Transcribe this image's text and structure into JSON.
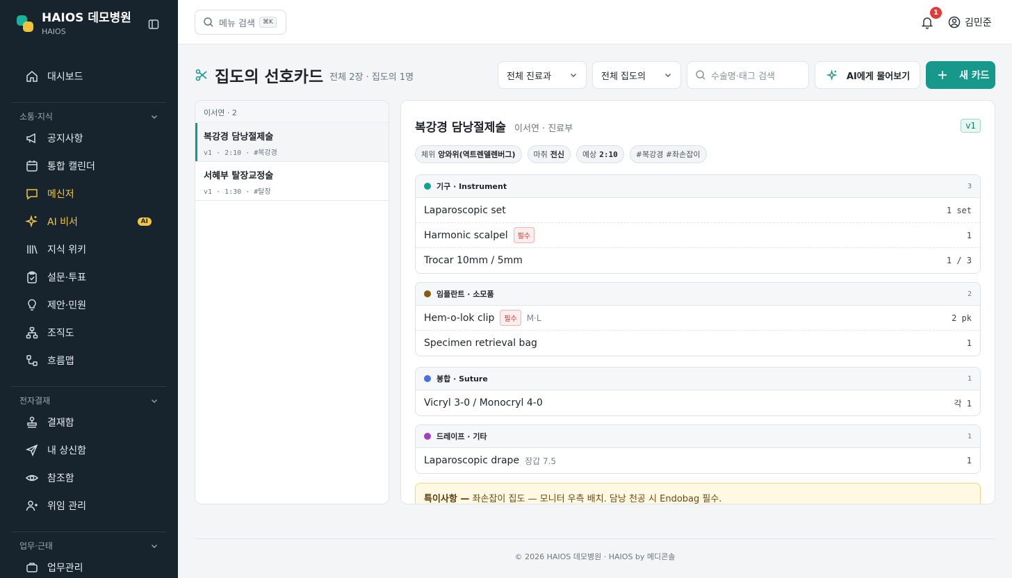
{
  "sidebar": {
    "brand_title": "HAIOS 데모병원",
    "brand_sub": "HAIOS",
    "main_item": "대시보드",
    "section1_label": "소통·지식",
    "section1_items": [
      "공지사항",
      "통합 캘린더",
      "메신저",
      "AI 비서",
      "지식 위키",
      "설문·투표",
      "제안·민원",
      "조직도",
      "흐름맵"
    ],
    "ai_badge": "AI",
    "section2_label": "전자결재",
    "section2_items": [
      "결재함",
      "내 상신함",
      "참조함",
      "위임 관리"
    ],
    "section3_label": "업무·근태",
    "section3_items": [
      "업무관리"
    ],
    "accent_color": "#f2c542"
  },
  "topbar": {
    "search_placeholder": "메뉴 검색",
    "shortcut": "⌘K",
    "notification_count": "1",
    "user_name": "김민준"
  },
  "page": {
    "title": "집도의 선호카드",
    "meta": "전체 2장 · 집도의 1명",
    "filter_dept": "전체 진료과",
    "filter_surgeon": "전체 집도의",
    "search_placeholder": "수술명·태그 검색",
    "ai_button": "AI에게 물어보기",
    "new_button": "새 카드",
    "brand_color": "#16998a"
  },
  "list": {
    "header": "이서연 · 2",
    "items": [
      {
        "title": "복강경 담낭절제술",
        "meta": "v1 · 2:10 · #복강경"
      },
      {
        "title": "서혜부 탈장교정술",
        "meta": "v1 · 1:30 · #탈장"
      }
    ]
  },
  "detail": {
    "title": "복강경 담낭절제술",
    "subtitle": "이서연 · 진료부",
    "version": "v1",
    "chips": [
      {
        "label": "체위",
        "value": "앙와위(역트렌델렌버그)"
      },
      {
        "label": "마취",
        "value": "전신"
      },
      {
        "label": "예상",
        "value": "2:10"
      },
      {
        "label": "",
        "value": "#복강경 #좌손잡이"
      }
    ],
    "groups": [
      {
        "title": "기구 · Instrument",
        "count": "3",
        "color": "#14a090",
        "rows": [
          {
            "name": "Laparoscopic set",
            "qty": "1 set",
            "required": "",
            "note": ""
          },
          {
            "name": "Harmonic scalpel",
            "qty": "1",
            "required": "필수",
            "note": ""
          },
          {
            "name": "Trocar 10mm / 5mm",
            "qty": "1 / 3",
            "required": "",
            "note": ""
          }
        ]
      },
      {
        "title": "임플란트 · 소모품",
        "count": "2",
        "color": "#8a5a14",
        "rows": [
          {
            "name": "Hem-o-lok clip",
            "qty": "2 pk",
            "required": "필수",
            "note": "M·L"
          },
          {
            "name": "Specimen retrieval bag",
            "qty": "1",
            "required": "",
            "note": ""
          }
        ]
      },
      {
        "title": "봉합 · Suture",
        "count": "1",
        "color": "#4a6fe0",
        "rows": [
          {
            "name": "Vicryl 3-0 / Monocryl 4-0",
            "qty": "각 1",
            "required": "",
            "note": ""
          }
        ]
      },
      {
        "title": "드레이프 · 기타",
        "count": "1",
        "color": "#a040c0",
        "rows": [
          {
            "name": "Laparoscopic drape",
            "qty": "1",
            "required": "",
            "note": "장갑 7.5"
          }
        ]
      }
    ],
    "special_label": "특이사항 —",
    "special_text": "좌손잡이 집도 — 모니터 우측 배치. 담낭 천공 시 Endobag 필수."
  },
  "footer": "© 2026 HAIOS 데모병원 · HAIOS by 메디콘솔"
}
